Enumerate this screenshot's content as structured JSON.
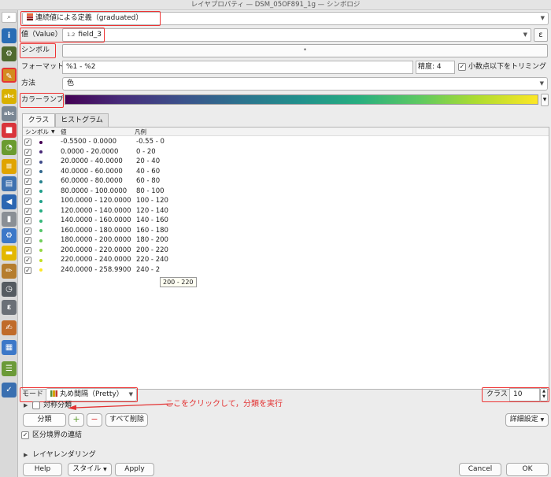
{
  "window": {
    "title": "レイヤプロパティ — DSM_05OF891_1g — シンボロジ"
  },
  "sidebar": {
    "search_glyph": "⌕",
    "icons": [
      {
        "name": "info-icon",
        "glyph": "i",
        "color": "#2a6db5"
      },
      {
        "name": "source-icon",
        "glyph": "⚙",
        "color": "#4f6a2f"
      },
      {
        "name": "symbology-icon",
        "glyph": "✎",
        "color": "#d48b1f"
      },
      {
        "name": "labels-icon",
        "glyph": "abc",
        "color": "#d9b100"
      },
      {
        "name": "masks-icon",
        "glyph": "abc",
        "color": "#7a8794"
      },
      {
        "name": "3d-view-icon",
        "glyph": "■",
        "color": "#d9343b"
      },
      {
        "name": "diagram-icon",
        "glyph": "◔",
        "color": "#6a9b2f"
      },
      {
        "name": "fields-icon",
        "glyph": "≡",
        "color": "#e0a400"
      },
      {
        "name": "attributes-form-icon",
        "glyph": "▤",
        "color": "#3f72b0"
      },
      {
        "name": "joins-icon",
        "glyph": "◀",
        "color": "#2b66b2"
      },
      {
        "name": "storage-icon",
        "glyph": "▮",
        "color": "#8a8f95"
      },
      {
        "name": "actions-icon",
        "glyph": "⚙",
        "color": "#3c78c8"
      },
      {
        "name": "display-icon",
        "glyph": "▬",
        "color": "#e3b800"
      },
      {
        "name": "rendering-icon",
        "glyph": "✏",
        "color": "#b57d2e"
      },
      {
        "name": "temporal-icon",
        "glyph": "◷",
        "color": "#555b61"
      },
      {
        "name": "variables-icon",
        "glyph": "ε",
        "color": "#6b7077"
      },
      {
        "name": "metadata-icon",
        "glyph": "✍",
        "color": "#c06b2a"
      },
      {
        "name": "dependencies-icon",
        "glyph": "▦",
        "color": "#3c78c8"
      },
      {
        "name": "legend-icon",
        "glyph": "☰",
        "color": "#6b9a38"
      },
      {
        "name": "server-icon",
        "glyph": "✓",
        "color": "#3a6fb0"
      }
    ]
  },
  "renderer": {
    "selected": "連続値による定義（graduated）"
  },
  "value_row": {
    "label": "値（Value）",
    "type_badge": "1.2",
    "field": "field_3",
    "expr_glyph": "ε"
  },
  "symbol_row": {
    "label": "シンボル",
    "preview": "•"
  },
  "format_row": {
    "label": "フォーマット",
    "value": "%1 - %2",
    "precision_label": "精度",
    "precision_value": "4",
    "trim_label": "小数点以下をトリミング",
    "trim_checked": "✓"
  },
  "method_row": {
    "label": "方法",
    "value": "色"
  },
  "ramp_row": {
    "label": "カラーランプ"
  },
  "tabs": [
    {
      "label": "クラス",
      "active": true
    },
    {
      "label": "ヒストグラム",
      "active": false
    }
  ],
  "table": {
    "headers": {
      "symbol": "シンボル",
      "sort": "▼",
      "value": "値",
      "legend": "凡例"
    },
    "check": "✓",
    "rows": [
      {
        "value": "-0.5500 - 0.0000",
        "legend": "-0.55 - 0",
        "color": "#440154"
      },
      {
        "value": "0.0000 - 20.0000",
        "legend": "0 - 20",
        "color": "#482878"
      },
      {
        "value": "20.0000 - 40.0000",
        "legend": "20 - 40",
        "color": "#3e4989"
      },
      {
        "value": "40.0000 - 60.0000",
        "legend": "40 - 60",
        "color": "#31688e"
      },
      {
        "value": "60.0000 - 80.0000",
        "legend": "60 - 80",
        "color": "#26828e"
      },
      {
        "value": "80.0000 - 100.0000",
        "legend": "80 - 100",
        "color": "#1f9e89"
      },
      {
        "value": "100.0000 - 120.0000",
        "legend": "100 - 120",
        "color": "#1fa088"
      },
      {
        "value": "120.0000 - 140.0000",
        "legend": "120 - 140",
        "color": "#26ad81"
      },
      {
        "value": "140.0000 - 160.0000",
        "legend": "140 - 160",
        "color": "#35b779"
      },
      {
        "value": "160.0000 - 180.0000",
        "legend": "160 - 180",
        "color": "#54c568"
      },
      {
        "value": "180.0000 - 200.0000",
        "legend": "180 - 200",
        "color": "#6ece58"
      },
      {
        "value": "200.0000 - 220.0000",
        "legend": "200 - 220",
        "color": "#95d840"
      },
      {
        "value": "220.0000 - 240.0000",
        "legend": "220 - 240",
        "color": "#c2df23"
      },
      {
        "value": "240.0000 - 258.9900",
        "legend": "240 - 2",
        "color": "#fde725"
      }
    ],
    "tooltip": "200 - 220"
  },
  "mode_row": {
    "label": "モード",
    "value": "丸め間隔（Pretty）"
  },
  "classes": {
    "label": "クラス",
    "value": "10"
  },
  "symmetric": {
    "label": "対称分類"
  },
  "annotation": {
    "text": "ここをクリックして，分類を実行",
    "color": "#e33333"
  },
  "actions": {
    "classify": "分類",
    "add_glyph": "+",
    "remove_glyph": "−",
    "delete_all": "すべて削除",
    "advanced": "詳細設定"
  },
  "link_bounds": {
    "label": "区分境界の連結",
    "checked": "✓"
  },
  "layer_rendering": {
    "label": "レイヤレンダリング"
  },
  "footer": {
    "help": "Help",
    "style": "スタイル",
    "apply": "Apply",
    "cancel": "Cancel",
    "ok": "OK"
  }
}
